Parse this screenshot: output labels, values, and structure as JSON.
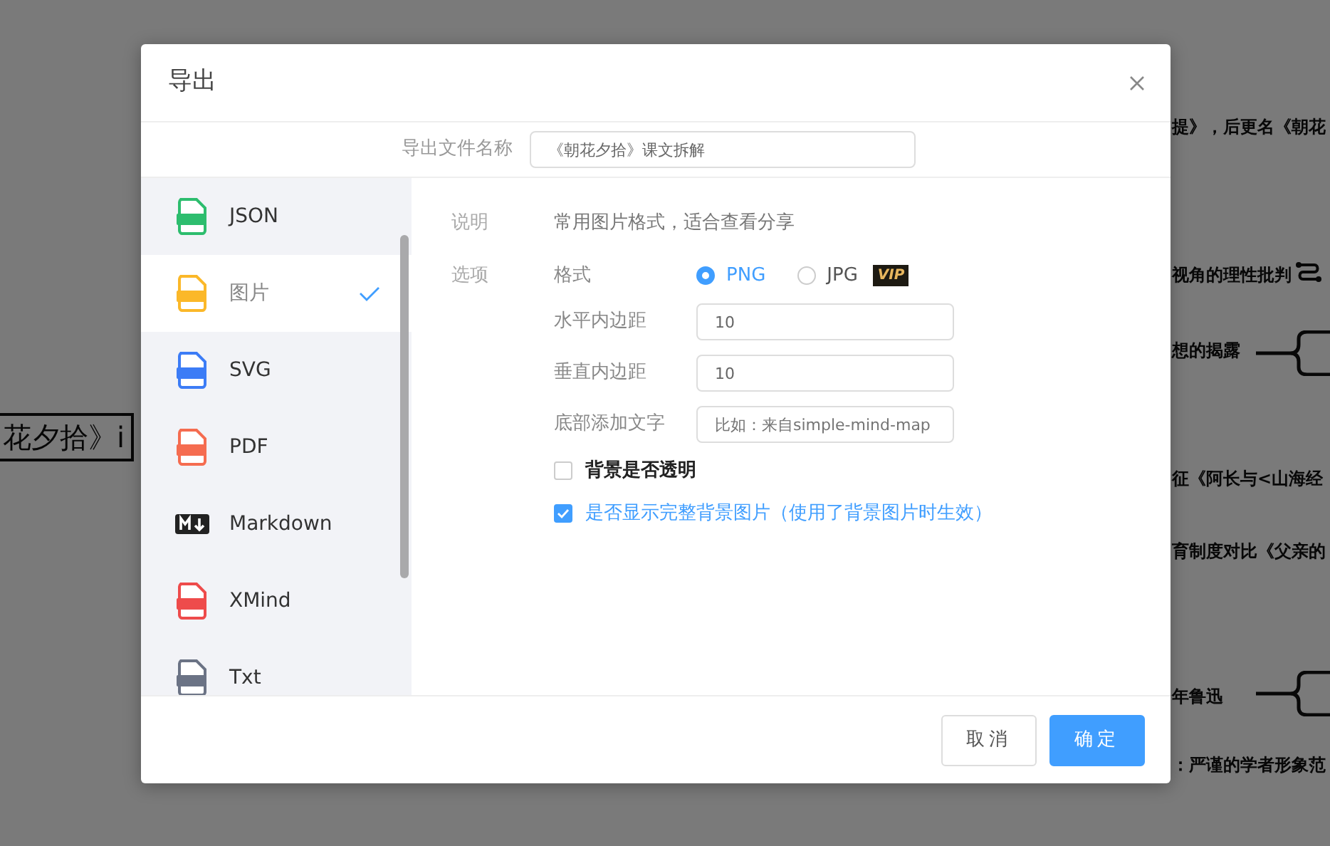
{
  "background": {
    "nodes": [
      {
        "text": "提》，后更名《朝花",
        "kind": "right"
      },
      {
        "text": "视角的理性批判",
        "kind": "right"
      },
      {
        "text": "想的揭露",
        "kind": "right"
      },
      {
        "text": "征《阿长与<山海经",
        "kind": "right"
      },
      {
        "text": "育制度对比《父亲的",
        "kind": "right"
      },
      {
        "text": "年鲁迅",
        "kind": "right"
      },
      {
        "text": "：严谨的学者形象范",
        "kind": "right"
      },
      {
        "text": "花夕拾》i",
        "kind": "root"
      }
    ]
  },
  "dialog": {
    "title": "导出",
    "filename": {
      "label": "导出文件名称",
      "value": "《朝花夕拾》课文拆解"
    },
    "formats": [
      {
        "label": "JSON",
        "selected": false,
        "kind": "file",
        "color": "#2dbd6e"
      },
      {
        "label": "图片",
        "selected": true,
        "kind": "file",
        "color": "#fbb829"
      },
      {
        "label": "SVG",
        "selected": false,
        "kind": "file",
        "color": "#3c7cf6"
      },
      {
        "label": "PDF",
        "selected": false,
        "kind": "file",
        "color": "#f56c50"
      },
      {
        "label": "Markdown",
        "selected": false,
        "kind": "markdown",
        "color": "#222222"
      },
      {
        "label": "XMind",
        "selected": false,
        "kind": "file",
        "color": "#ee4b4b"
      },
      {
        "label": "Txt",
        "selected": false,
        "kind": "file",
        "color": "#6b7385"
      }
    ],
    "description": {
      "label": "说明",
      "text": "常用图片格式，适合查看分享"
    },
    "options": {
      "label": "选项",
      "format": {
        "label": "格式",
        "choices": [
          {
            "label": "PNG",
            "selected": true
          },
          {
            "label": "JPG",
            "selected": false,
            "badge": "VIP"
          }
        ]
      },
      "fields": [
        {
          "label": "水平内边距",
          "value": "10"
        },
        {
          "label": "垂直内边距",
          "value": "10"
        },
        {
          "label": "底部添加文字",
          "placeholder": "比如：来自simple-mind-map"
        }
      ],
      "checkboxes": [
        {
          "label": "背景是否透明",
          "checked": false
        },
        {
          "label": "是否显示完整背景图片（使用了背景图片时生效）",
          "checked": true
        }
      ]
    },
    "buttons": [
      {
        "label": "取消",
        "kind": "secondary"
      },
      {
        "label": "确定",
        "kind": "primary"
      }
    ]
  }
}
